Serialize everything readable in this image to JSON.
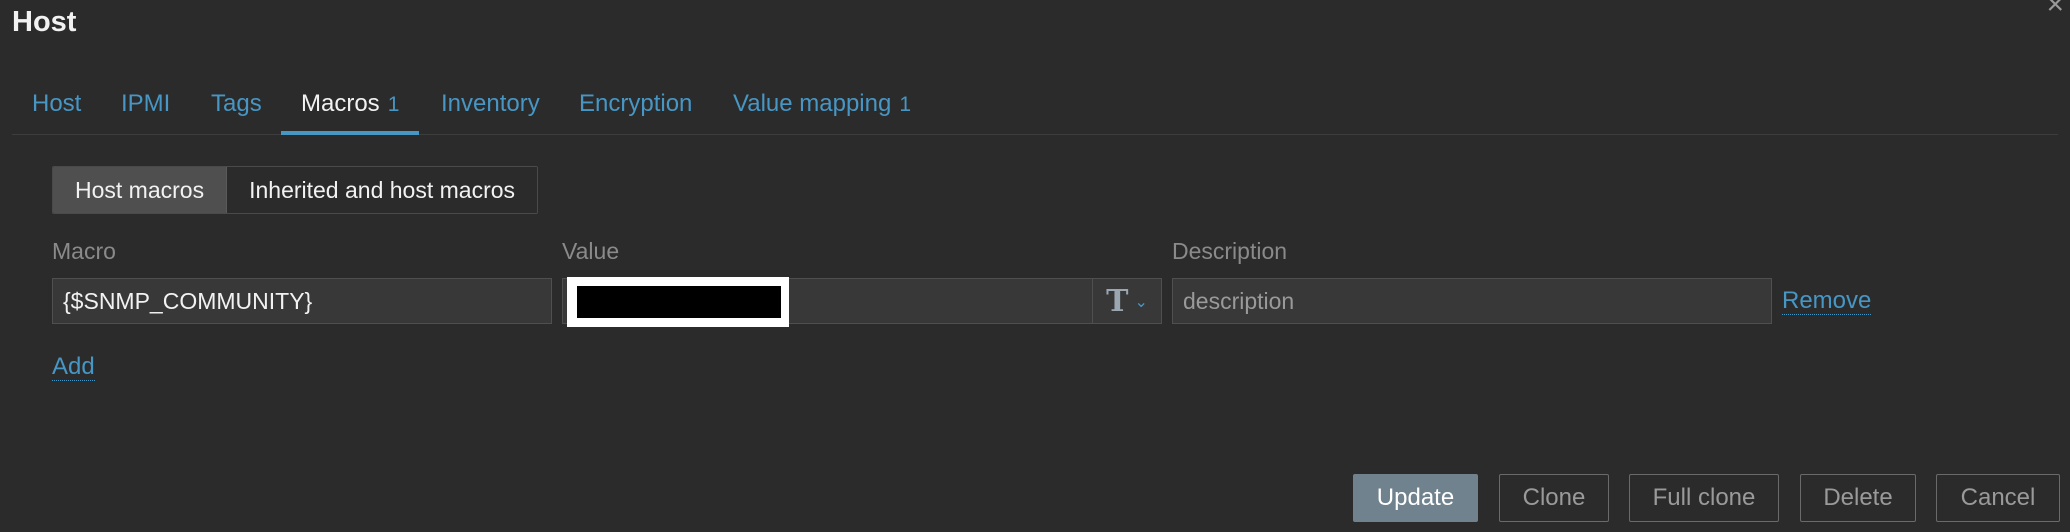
{
  "dialog": {
    "title": "Host"
  },
  "tabs": [
    {
      "label": "Host",
      "count": ""
    },
    {
      "label": "IPMI",
      "count": ""
    },
    {
      "label": "Tags",
      "count": ""
    },
    {
      "label": "Macros",
      "count": "1"
    },
    {
      "label": "Inventory",
      "count": ""
    },
    {
      "label": "Encryption",
      "count": ""
    },
    {
      "label": "Value mapping",
      "count": "1"
    }
  ],
  "active_tab": "Macros",
  "macro_view": {
    "options": [
      "Host macros",
      "Inherited and host macros"
    ],
    "selected": "Host macros"
  },
  "columns": {
    "macro": "Macro",
    "value": "Value",
    "description": "Description"
  },
  "macro_rows": [
    {
      "macro": "{$SNMP_COMMUNITY}",
      "value_redacted": true,
      "value_type_icon": "T",
      "description_placeholder": "description",
      "remove_label": "Remove"
    }
  ],
  "add_label": "Add",
  "footer": {
    "update": "Update",
    "clone": "Clone",
    "full_clone": "Full clone",
    "delete": "Delete",
    "cancel": "Cancel"
  },
  "colors": {
    "background": "#2b2b2b",
    "link": "#4796c4",
    "primary_button": "#70828e"
  }
}
